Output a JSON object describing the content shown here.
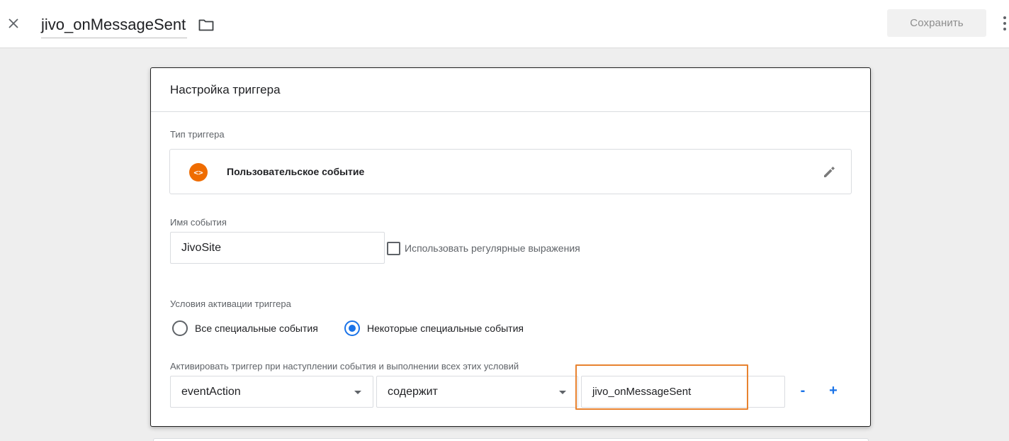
{
  "header": {
    "title": "jivo_onMessageSent",
    "save_label": "Сохранить"
  },
  "card": {
    "title": "Настройка триггера",
    "trigger_type_label": "Тип триггера",
    "trigger_type_name": "Пользовательское событие",
    "trigger_type_icon": "<>",
    "event_name_label": "Имя события",
    "event_name_value": "JivoSite",
    "regex_checkbox_label": "Использовать регулярные выражения",
    "regex_checked": false,
    "activation_label": "Условия активации триггера",
    "activation_options": [
      {
        "label": "Все специальные события",
        "selected": false
      },
      {
        "label": "Некоторые специальные события",
        "selected": true
      }
    ],
    "condition_label": "Активировать триггер при наступлении события и выполнении всех этих условий",
    "condition": {
      "variable": "eventAction",
      "operator": "содержит",
      "value": "jivo_onMessageSent"
    },
    "remove_label": "-",
    "add_label": "+"
  },
  "colors": {
    "accent": "#1a73e8",
    "icon_orange": "#ef6c00",
    "highlight": "#e8822f"
  }
}
